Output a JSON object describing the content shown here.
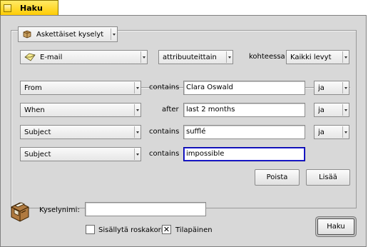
{
  "window": {
    "title": "Haku"
  },
  "recent": {
    "label": "Äskettäiset kyselyt"
  },
  "search_type": {
    "selected": "E-mail"
  },
  "method": {
    "selected": "attribuuteittain"
  },
  "target": {
    "label": "kohteessa",
    "selected": "Kaikki levyt"
  },
  "rows": [
    {
      "attribute": "From",
      "operator": "contains",
      "value": "Clara Oswald",
      "conjunction": "ja"
    },
    {
      "attribute": "When",
      "operator": "after",
      "value": "last 2 months",
      "conjunction": "ja"
    },
    {
      "attribute": "Subject",
      "operator": "contains",
      "value": "sufflé",
      "conjunction": "ja"
    },
    {
      "attribute": "Subject",
      "operator": "contains",
      "value": "impossible"
    }
  ],
  "buttons": {
    "remove": "Poista",
    "add": "Lisää",
    "search": "Haku"
  },
  "query_name": {
    "label": "Kyselynimi:",
    "value": ""
  },
  "options": {
    "include_trash": {
      "label": "Sisällytä roskakori",
      "checked": false,
      "mark": ""
    },
    "temporary": {
      "label": "Tilapäinen",
      "checked": true,
      "mark": "✕"
    }
  },
  "icons": {
    "recent": "query-package-icon",
    "email": "email-envelope-icon",
    "query": "file-cabinet-drawer-icon"
  }
}
